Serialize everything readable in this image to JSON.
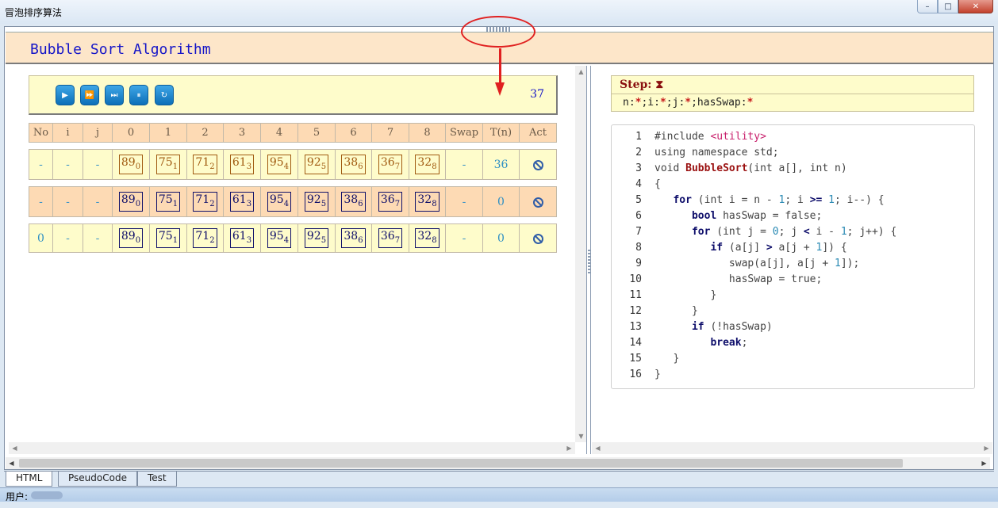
{
  "window": {
    "title": "冒泡排序算法",
    "min_label": "–",
    "restore_label": "□",
    "close_label": "✕"
  },
  "header": {
    "title": "Bubble Sort Algorithm"
  },
  "controls": {
    "buttons": [
      {
        "name": "play",
        "glyph": "▶"
      },
      {
        "name": "step-forward",
        "glyph": "⏩"
      },
      {
        "name": "skip-to-end",
        "glyph": "⏭"
      },
      {
        "name": "pause",
        "glyph": "⏸"
      },
      {
        "name": "reset",
        "glyph": "↻"
      }
    ],
    "counter": "37"
  },
  "table": {
    "headers": [
      "No",
      "i",
      "j",
      "0",
      "1",
      "2",
      "3",
      "4",
      "5",
      "6",
      "7",
      "8",
      "Swap",
      "T(n)",
      "Act"
    ],
    "rows": [
      {
        "no": "-",
        "i": "-",
        "j": "-",
        "values": [
          [
            "89",
            "0"
          ],
          [
            "75",
            "1"
          ],
          [
            "71",
            "2"
          ],
          [
            "61",
            "3"
          ],
          [
            "95",
            "4"
          ],
          [
            "92",
            "5"
          ],
          [
            "38",
            "6"
          ],
          [
            "36",
            "7"
          ],
          [
            "32",
            "8"
          ]
        ],
        "swap": "-",
        "tn": "36"
      },
      {
        "no": "-",
        "i": "-",
        "j": "-",
        "values": [
          [
            "89",
            "0"
          ],
          [
            "75",
            "1"
          ],
          [
            "71",
            "2"
          ],
          [
            "61",
            "3"
          ],
          [
            "95",
            "4"
          ],
          [
            "92",
            "5"
          ],
          [
            "38",
            "6"
          ],
          [
            "36",
            "7"
          ],
          [
            "32",
            "8"
          ]
        ],
        "swap": "-",
        "tn": "0"
      },
      {
        "no": "0",
        "i": "-",
        "j": "-",
        "values": [
          [
            "89",
            "0"
          ],
          [
            "75",
            "1"
          ],
          [
            "71",
            "2"
          ],
          [
            "61",
            "3"
          ],
          [
            "95",
            "4"
          ],
          [
            "92",
            "5"
          ],
          [
            "38",
            "6"
          ],
          [
            "36",
            "7"
          ],
          [
            "32",
            "8"
          ]
        ],
        "swap": "-",
        "tn": "0"
      }
    ]
  },
  "step": {
    "label": "Step:",
    "icon": "hourglass-icon",
    "icon_glyph": "⧗",
    "vars": [
      {
        "name": "n:",
        "value": "*"
      },
      {
        "name": ";i:",
        "value": "*"
      },
      {
        "name": ";j:",
        "value": "*"
      },
      {
        "name": ";hasSwap:",
        "value": "*"
      }
    ]
  },
  "code": {
    "lines": [
      {
        "n": "1",
        "parts": [
          [
            "",
            "#include "
          ],
          [
            "str",
            "<utility>"
          ]
        ]
      },
      {
        "n": "2",
        "parts": [
          [
            "",
            "using namespace std;"
          ]
        ]
      },
      {
        "n": "3",
        "parts": [
          [
            "",
            "void "
          ],
          [
            "fn",
            "BubbleSort"
          ],
          [
            "",
            "(int a[], int n)"
          ]
        ]
      },
      {
        "n": "4",
        "parts": [
          [
            "",
            "{"
          ]
        ]
      },
      {
        "n": "5",
        "parts": [
          [
            "",
            "   "
          ],
          [
            "kw",
            "for"
          ],
          [
            "",
            " (int i = n - "
          ],
          [
            "nm",
            "1"
          ],
          [
            "",
            "; i "
          ],
          [
            "kw",
            ">="
          ],
          [
            "",
            " "
          ],
          [
            "nm",
            "1"
          ],
          [
            "",
            "; i--) {"
          ]
        ]
      },
      {
        "n": "6",
        "parts": [
          [
            "",
            "      "
          ],
          [
            "kw",
            "bool"
          ],
          [
            "",
            " hasSwap = false;"
          ]
        ]
      },
      {
        "n": "7",
        "parts": [
          [
            "",
            "      "
          ],
          [
            "kw",
            "for"
          ],
          [
            "",
            " (int j = "
          ],
          [
            "nm",
            "0"
          ],
          [
            "",
            "; j "
          ],
          [
            "kw",
            "<"
          ],
          [
            "",
            " i - "
          ],
          [
            "nm",
            "1"
          ],
          [
            "",
            "; j++) {"
          ]
        ]
      },
      {
        "n": "8",
        "parts": [
          [
            "",
            "         "
          ],
          [
            "kw",
            "if"
          ],
          [
            "",
            " (a[j] "
          ],
          [
            "kw",
            ">"
          ],
          [
            "",
            " a[j + "
          ],
          [
            "nm",
            "1"
          ],
          [
            "",
            "]) {"
          ]
        ]
      },
      {
        "n": "9",
        "parts": [
          [
            "",
            "            swap(a[j], a[j + "
          ],
          [
            "nm",
            "1"
          ],
          [
            "",
            "]);"
          ]
        ]
      },
      {
        "n": "10",
        "parts": [
          [
            "",
            "            hasSwap = true;"
          ]
        ]
      },
      {
        "n": "11",
        "parts": [
          [
            "",
            "         }"
          ]
        ]
      },
      {
        "n": "12",
        "parts": [
          [
            "",
            "      }"
          ]
        ]
      },
      {
        "n": "13",
        "parts": [
          [
            "",
            "      "
          ],
          [
            "kw",
            "if"
          ],
          [
            "",
            " (!hasSwap)"
          ]
        ]
      },
      {
        "n": "14",
        "parts": [
          [
            "",
            "         "
          ],
          [
            "kw",
            "break"
          ],
          [
            "",
            ";"
          ]
        ]
      },
      {
        "n": "15",
        "parts": [
          [
            "",
            "   }"
          ]
        ]
      },
      {
        "n": "16",
        "parts": [
          [
            "",
            "}"
          ]
        ]
      }
    ]
  },
  "tabs": [
    {
      "label": "HTML",
      "active": true
    },
    {
      "label": "PseudoCode",
      "active": false
    },
    {
      "label": "Test",
      "active": false
    }
  ],
  "status": {
    "label": "用户:"
  },
  "colors": {
    "accent": "#e02020",
    "header_bg": "#fde6c9",
    "panel_bg": "#fefccb",
    "title_blue": "#1515c8"
  }
}
